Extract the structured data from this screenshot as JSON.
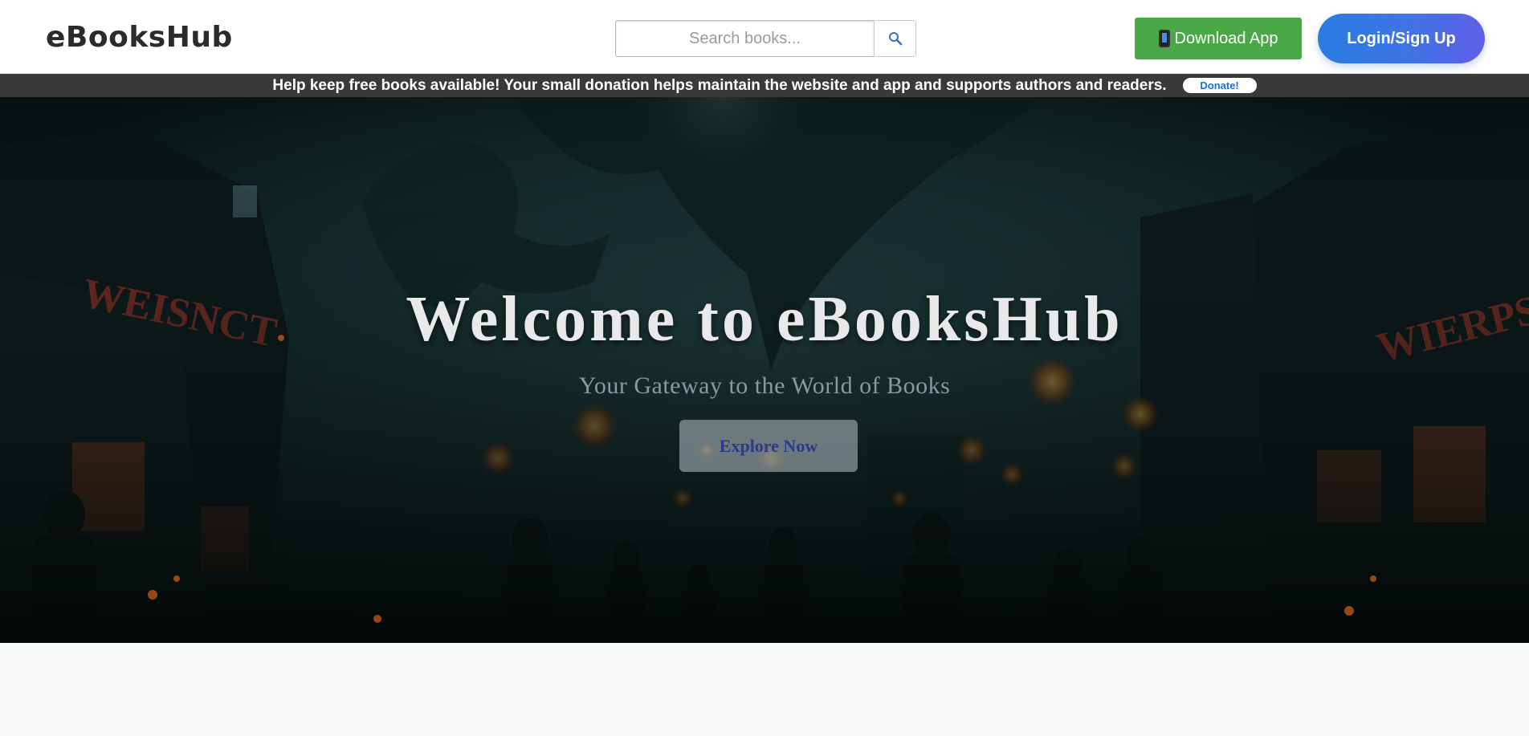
{
  "header": {
    "logo": "eBooksHub",
    "search_placeholder": "Search books...",
    "search_icon": "magnifier-icon",
    "download_label": "Download App",
    "download_icon": "phone-icon",
    "login_label": "Login/Sign Up"
  },
  "donation": {
    "message": "Help keep free books available! Your small donation helps maintain the website and app and supports authors and readers.",
    "button_label": "Donate!"
  },
  "hero": {
    "title": "Welcome to eBooksHub",
    "subtitle": "Your Gateway to the World of Books",
    "cta_label": "Explore Now"
  },
  "colors": {
    "download_green": "#4aa846",
    "login_gradient_start": "#2a7de1",
    "login_gradient_end": "#6060e6",
    "donate_bar": "#3a3a3a",
    "hero_teal": "#0d1e20"
  }
}
